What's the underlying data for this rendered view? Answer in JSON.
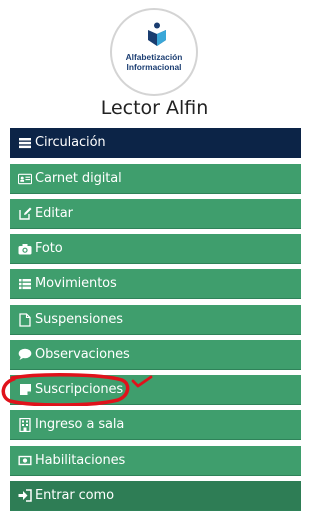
{
  "profile": {
    "logo_line1": "Alfabetización",
    "logo_line2": "Informacional",
    "name": "Lector Alfin"
  },
  "menu": {
    "items": [
      {
        "label": "Circulación",
        "icon": "list-icon",
        "active": true
      },
      {
        "label": "Carnet digital",
        "icon": "id-card-icon"
      },
      {
        "label": "Editar",
        "icon": "edit-icon"
      },
      {
        "label": "Foto",
        "icon": "camera-icon"
      },
      {
        "label": "Movimientos",
        "icon": "list-icon"
      },
      {
        "label": "Suspensiones",
        "icon": "file-icon"
      },
      {
        "label": "Observaciones",
        "icon": "comment-icon"
      },
      {
        "label": "Suscripciones",
        "icon": "sticky-note-icon"
      },
      {
        "label": "Ingreso a sala",
        "icon": "building-icon"
      },
      {
        "label": "Habilitaciones",
        "icon": "money-icon"
      },
      {
        "label": "Entrar como",
        "icon": "sign-in-icon"
      }
    ]
  },
  "colors": {
    "menu_bg": "#3f9e6d",
    "menu_active_bg": "#0c2447",
    "annotation": "#e0121b"
  }
}
